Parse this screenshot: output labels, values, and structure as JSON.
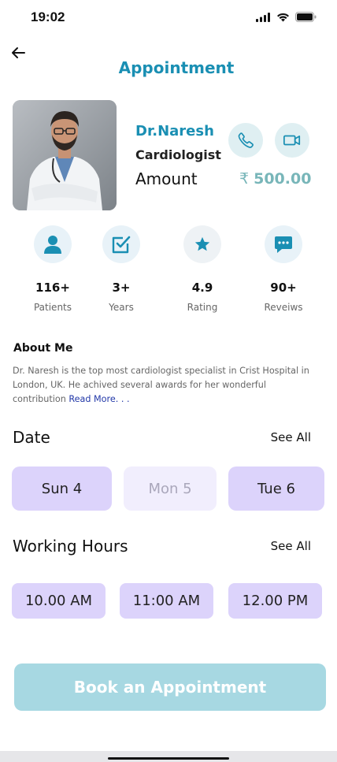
{
  "status_bar": {
    "time": "19:02"
  },
  "header": {
    "title": "Appointment"
  },
  "doctor": {
    "name": "Dr.Naresh",
    "specialty": "Cardiologist",
    "amount_label": "Amount",
    "currency_symbol": "₹",
    "amount_value": "500.00"
  },
  "stats": [
    {
      "value": "116+",
      "label": "Patients",
      "icon": "person-icon"
    },
    {
      "value": "3+",
      "label": "Years",
      "icon": "checkbox-icon"
    },
    {
      "value": "4.9",
      "label": "Rating",
      "icon": "star-icon"
    },
    {
      "value": "90+",
      "label": "Reveiws",
      "icon": "chat-icon"
    }
  ],
  "about": {
    "title": "About Me",
    "text": "Dr. Naresh is the top most cardiologist specialist in Crist Hospital in London, UK. He achived several awards for her wonderful contribution ",
    "read_more": "Read More. . ."
  },
  "date_section": {
    "title": "Date",
    "see_all": "See All",
    "dates": [
      "Sun 4",
      "Mon 5",
      "Tue 6"
    ]
  },
  "hours_section": {
    "title": "Working Hours",
    "see_all": "See All",
    "hours": [
      "10.00 AM",
      "11:00 AM",
      "12.00 PM"
    ]
  },
  "book_button": "Book an Appointment",
  "colors": {
    "accent": "#1a8fb3",
    "amount": "#78b6b9",
    "pill": "#dcd3fb",
    "pill_faded": "#f1eefd",
    "book_button": "#a7d8e2",
    "icon_circle": "#e8f2f8"
  }
}
